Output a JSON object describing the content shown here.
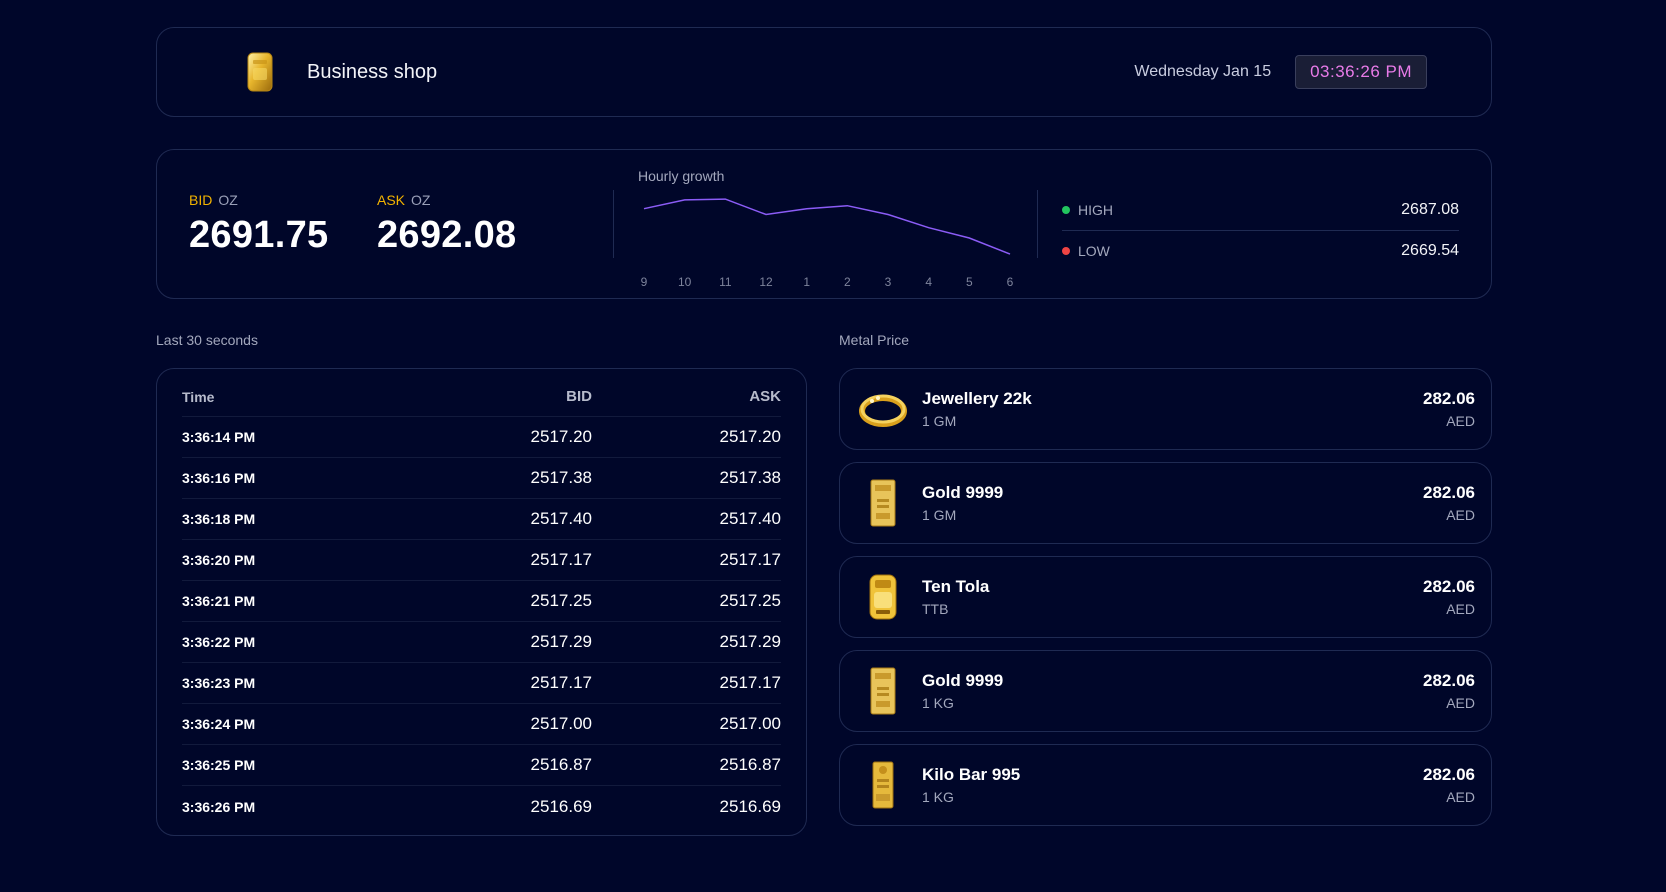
{
  "header": {
    "title": "Business shop",
    "logo_icon": "gold-bar-icon",
    "date": "Wednesday Jan 15",
    "time": "03:36:26 PM"
  },
  "stats": {
    "bid": {
      "label": "BID",
      "unit": "OZ",
      "value": "2691.75"
    },
    "ask": {
      "label": "ASK",
      "unit": "OZ",
      "value": "2692.08"
    },
    "chart_title": "Hourly growth",
    "high": {
      "label": "HIGH",
      "value": "2687.08",
      "color": "#22c55e"
    },
    "low": {
      "label": "LOW",
      "value": "2669.54",
      "color": "#ef4444"
    },
    "accent_color": "#f2b300",
    "line_color": "#8b5cf6"
  },
  "chart_data": {
    "type": "line",
    "title": "Hourly growth",
    "categories": [
      "9",
      "10",
      "11",
      "12",
      "1",
      "2",
      "3",
      "4",
      "5",
      "6"
    ],
    "values": [
      70,
      82,
      83,
      62,
      70,
      74,
      62,
      44,
      30,
      8
    ],
    "ylim": [
      0,
      90
    ],
    "grid": false
  },
  "trades": {
    "section_label": "Last 30 seconds",
    "columns": [
      "Time",
      "BID",
      "ASK"
    ],
    "rows": [
      [
        "3:36:14 PM",
        "2517.20",
        "2517.20"
      ],
      [
        "3:36:16 PM",
        "2517.38",
        "2517.38"
      ],
      [
        "3:36:18 PM",
        "2517.40",
        "2517.40"
      ],
      [
        "3:36:20 PM",
        "2517.17",
        "2517.17"
      ],
      [
        "3:36:21 PM",
        "2517.25",
        "2517.25"
      ],
      [
        "3:36:22 PM",
        "2517.29",
        "2517.29"
      ],
      [
        "3:36:23 PM",
        "2517.17",
        "2517.17"
      ],
      [
        "3:36:24 PM",
        "2517.00",
        "2517.00"
      ],
      [
        "3:36:25 PM",
        "2516.87",
        "2516.87"
      ],
      [
        "3:36:26 PM",
        "2516.69",
        "2516.69"
      ]
    ]
  },
  "metals": {
    "section_label": "Metal Price",
    "items": [
      {
        "name": "Jewellery 22k",
        "unit": "1 GM",
        "price": "282.06",
        "currency": "AED",
        "icon": "gold-ring-icon"
      },
      {
        "name": "Gold 9999",
        "unit": "1 GM",
        "price": "282.06",
        "currency": "AED",
        "icon": "gold-bar-icon"
      },
      {
        "name": "Ten Tola",
        "unit": "TTB",
        "price": "282.06",
        "currency": "AED",
        "icon": "gold-tola-icon"
      },
      {
        "name": "Gold 9999",
        "unit": "1 KG",
        "price": "282.06",
        "currency": "AED",
        "icon": "gold-bar-icon"
      },
      {
        "name": "Kilo Bar 995",
        "unit": "1 KG",
        "price": "282.06",
        "currency": "AED",
        "icon": "kilo-bar-icon"
      }
    ]
  }
}
